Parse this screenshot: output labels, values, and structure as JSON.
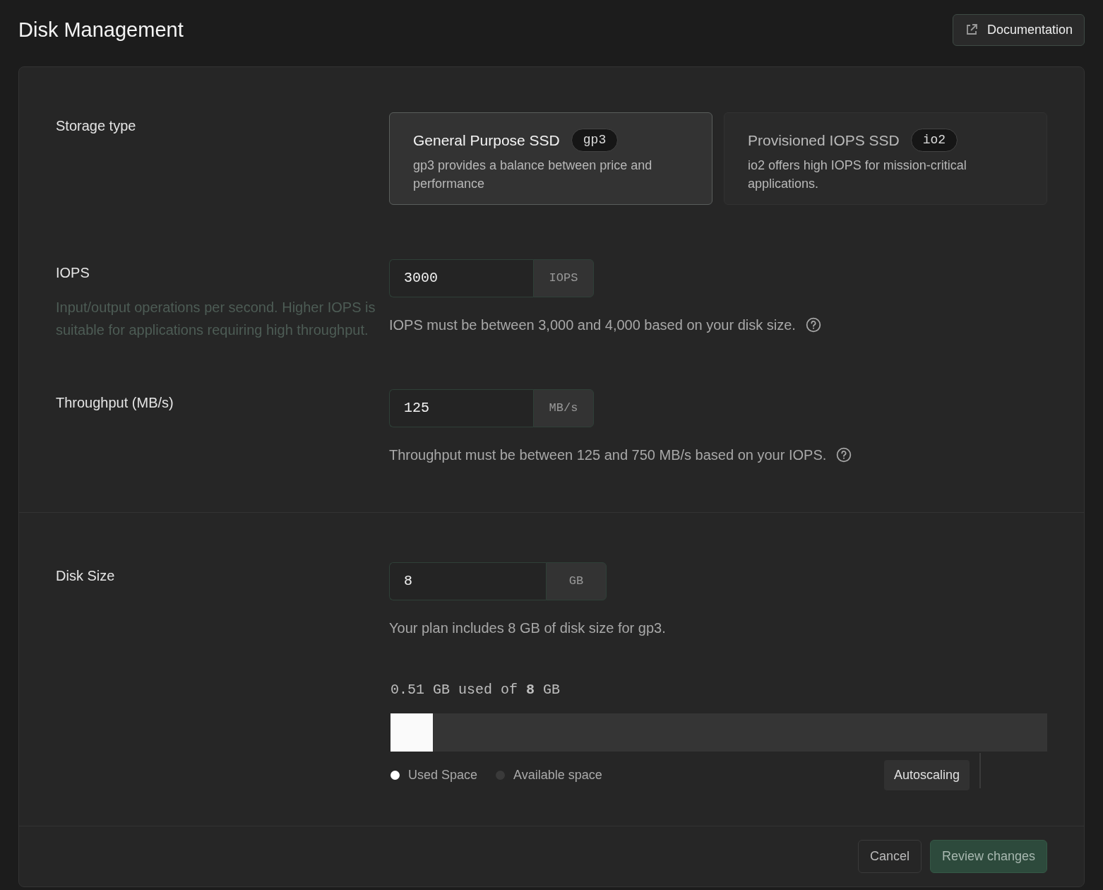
{
  "page": {
    "title": "Disk Management",
    "documentation_button": "Documentation"
  },
  "storage_type": {
    "label": "Storage type",
    "options": [
      {
        "title": "General Purpose SSD",
        "tag": "gp3",
        "description": "gp3 provides a balance between price and performance",
        "selected": true
      },
      {
        "title": "Provisioned IOPS SSD",
        "tag": "io2",
        "description": "io2 offers high IOPS for mission-critical applications.",
        "selected": false
      }
    ]
  },
  "iops": {
    "label": "IOPS",
    "description": "Input/output operations per second. Higher IOPS is suitable for applications requiring high throughput.",
    "value": "3000",
    "unit": "IOPS",
    "help": "IOPS must be between 3,000 and 4,000 based on your disk size."
  },
  "throughput": {
    "label": "Throughput (MB/s)",
    "value": "125",
    "unit": "MB/s",
    "help": "Throughput must be between 125 and 750 MB/s based on your IOPS."
  },
  "disk_size": {
    "label": "Disk Size",
    "value": "8",
    "unit": "GB",
    "help": "Your plan includes 8 GB of disk size for gp3.",
    "usage_text": "0.51 GB used of **8** GB",
    "level": 0.064,
    "legend": [
      {
        "label": "Used Space",
        "color": "#ffffff"
      },
      {
        "label": "Available space",
        "color": "#3a3a3a"
      }
    ],
    "autoscaling_button": "Autoscaling"
  },
  "footer": {
    "buttons": [
      {
        "label": "Cancel",
        "kind": "secondary"
      },
      {
        "label": "Review changes",
        "kind": "primary"
      }
    ]
  }
}
